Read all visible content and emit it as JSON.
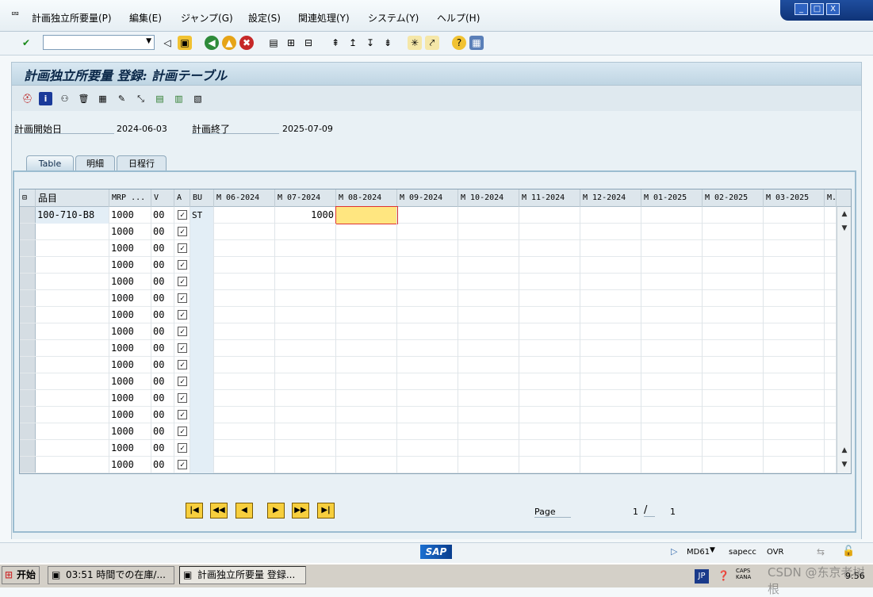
{
  "menu": [
    "計画独立所要量(P)",
    "編集(E)",
    "ジャンプ(G)",
    "設定(S)",
    "関連処理(Y)",
    "システム(Y)",
    "ヘルプ(H)"
  ],
  "window_controls": [
    "_",
    "□",
    "X"
  ],
  "screen_title": "計画独立所要量 登録:  計画テーブル",
  "fields": {
    "start_label": "計画開始日",
    "start_value": "2024-06-03",
    "end_label": "計画終了",
    "end_value": "2025-07-09"
  },
  "tabs": [
    "Table",
    "明細",
    "日程行"
  ],
  "grid": {
    "columns": [
      "品目",
      "MRP ...",
      "V",
      "A",
      "BU",
      "M 06-2024",
      "M 07-2024",
      "M 08-2024",
      "M 09-2024",
      "M 10-2024",
      "M 11-2024",
      "M 12-2024",
      "M 01-2025",
      "M 02-2025",
      "M 03-2025",
      "M."
    ],
    "rows": [
      {
        "material": "100-710-B8",
        "mrp": "1000",
        "v": "00",
        "checked": true,
        "bu": "ST",
        "m07": "1000"
      },
      {
        "material": "",
        "mrp": "1000",
        "v": "00",
        "checked": true,
        "bu": "",
        "m07": ""
      },
      {
        "material": "",
        "mrp": "1000",
        "v": "00",
        "checked": true,
        "bu": "",
        "m07": ""
      },
      {
        "material": "",
        "mrp": "1000",
        "v": "00",
        "checked": true,
        "bu": "",
        "m07": ""
      },
      {
        "material": "",
        "mrp": "1000",
        "v": "00",
        "checked": true,
        "bu": "",
        "m07": ""
      },
      {
        "material": "",
        "mrp": "1000",
        "v": "00",
        "checked": true,
        "bu": "",
        "m07": ""
      },
      {
        "material": "",
        "mrp": "1000",
        "v": "00",
        "checked": true,
        "bu": "",
        "m07": ""
      },
      {
        "material": "",
        "mrp": "1000",
        "v": "00",
        "checked": true,
        "bu": "",
        "m07": ""
      },
      {
        "material": "",
        "mrp": "1000",
        "v": "00",
        "checked": true,
        "bu": "",
        "m07": ""
      },
      {
        "material": "",
        "mrp": "1000",
        "v": "00",
        "checked": true,
        "bu": "",
        "m07": ""
      },
      {
        "material": "",
        "mrp": "1000",
        "v": "00",
        "checked": true,
        "bu": "",
        "m07": ""
      },
      {
        "material": "",
        "mrp": "1000",
        "v": "00",
        "checked": true,
        "bu": "",
        "m07": ""
      },
      {
        "material": "",
        "mrp": "1000",
        "v": "00",
        "checked": true,
        "bu": "",
        "m07": ""
      },
      {
        "material": "",
        "mrp": "1000",
        "v": "00",
        "checked": true,
        "bu": "",
        "m07": ""
      },
      {
        "material": "",
        "mrp": "1000",
        "v": "00",
        "checked": true,
        "bu": "",
        "m07": ""
      },
      {
        "material": "",
        "mrp": "1000",
        "v": "00",
        "checked": true,
        "bu": "",
        "m07": ""
      }
    ]
  },
  "paging": {
    "label": "Page",
    "current": "1",
    "separator": "/",
    "total": "1"
  },
  "status": {
    "sap_logo": "SAP",
    "transaction": "MD61",
    "system": "sapecc",
    "mode": "OVR"
  },
  "taskbar": {
    "start": "开始",
    "tasks": [
      "03:51 時間での在庫/...",
      "計画独立所要量 登録..."
    ],
    "lang": "JP",
    "tray_text": "CAPS KANA",
    "clock": "9:56",
    "watermark": "CSDN @东京老树根"
  },
  "colors": {
    "accent": "#0f3478",
    "focus_cell": "#ffe680",
    "nav_button": "#f7cf3d"
  }
}
